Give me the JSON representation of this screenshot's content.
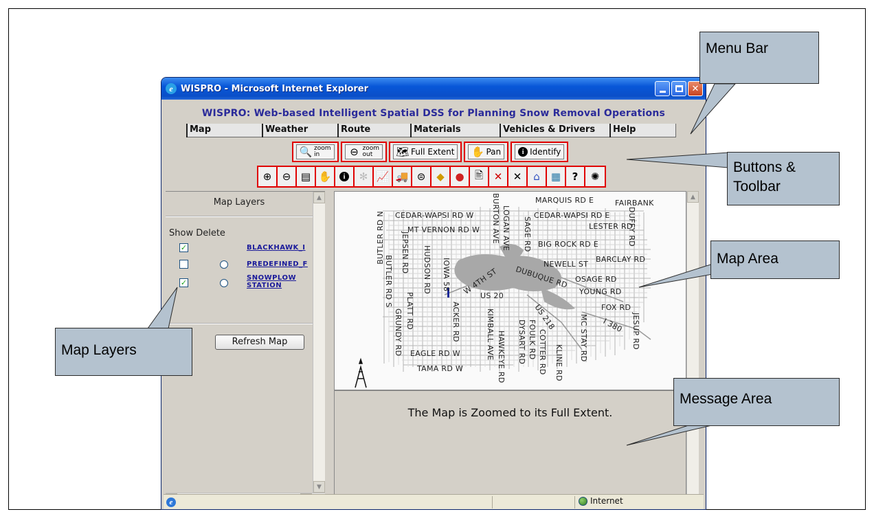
{
  "window": {
    "title": "WISPRO - Microsoft Internet Explorer"
  },
  "app": {
    "title": "WISPRO: Web-based Intelligent Spatial DSS for Planning Snow Removal Operations"
  },
  "menu": [
    "Map",
    "Weather",
    "Route",
    "Materials",
    "Vehicles & Drivers",
    "Help"
  ],
  "buttons": {
    "zoom_in_top": "zoom",
    "zoom_in_bottom": "in",
    "zoom_out_top": "zoom",
    "zoom_out_bottom": "out",
    "full_extent": "Full Extent",
    "pan": "Pan",
    "identify": "Identify"
  },
  "toolbar_icons": [
    "zoom-in-icon",
    "zoom-out-icon",
    "full-extent-icon",
    "pan-icon",
    "identify-icon",
    "settings-icon",
    "chart-icon",
    "truck-icon",
    "steering-wheel-icon",
    "warning-sign-icon",
    "stop-light-icon",
    "document-icon",
    "delete-icon",
    "clear-icon",
    "depot-icon",
    "calendar-icon",
    "help-icon",
    "alert-icon"
  ],
  "left_panel": {
    "title": "Map Layers",
    "col_show": "Show",
    "col_delete": "Delete",
    "layers": [
      {
        "name": "BLACKHAWK_I",
        "show": true,
        "has_delete": false
      },
      {
        "name": "PREDEFINED_F",
        "show": false,
        "has_delete": true
      },
      {
        "name": "SNOWPLOW",
        "name2": "STATION",
        "show": true,
        "has_delete": true
      }
    ],
    "refresh_label": "Refresh Map"
  },
  "map": {
    "labels": {
      "marquis": "MARQUIS RD E",
      "fairbank": "FAIRBANK",
      "cedar_w": "CEDAR-WAPSI RD W",
      "cedar_e": "CEDAR-WAPSI RD E",
      "lester": "LESTER RD",
      "mt_vernon": "MT VERNON RD W",
      "big_rock": "BIG ROCK RD E",
      "barclay": "BARCLAY RD",
      "newell": "NEWELL ST",
      "osage": "OSAGE RD",
      "young": "YOUNG RD",
      "dubuque": "DUBUQUE RD",
      "w4th": "W 4TH ST",
      "us20": "US 20",
      "fox": "FOX RD",
      "i380": "I 380",
      "us218": "US 218",
      "eagle": "EAGLE RD W",
      "tama": "TAMA RD W",
      "butler_n": "BUTLER RD N",
      "butler_s": "BUTLER RD S",
      "jepsen": "JEPSEN RD",
      "hudson": "HUDSON RD",
      "iowa58": "IOWA 58",
      "platt": "PLATT RD",
      "grundy": "GRUNDY RD",
      "acker": "ACKER RD",
      "burton": "BURTON AVE",
      "logan": "LOGAN AVE",
      "sage": "SAGE RD",
      "duffy": "DUFFY RD",
      "kimball": "KIMBALL AVE",
      "hawkeye": "HAWKEYE RD",
      "dysart": "DYSART RD",
      "foulk": "FOULK RD",
      "cotter": "COTTER RD",
      "kline": "KLINE RD",
      "mcstay": "MC STAY RD",
      "jesup": "JESUP RD"
    }
  },
  "message": "The Map is Zoomed to its Full Extent.",
  "status": {
    "zone": "Internet"
  },
  "callouts": {
    "menu_bar": "Menu Bar",
    "buttons_1": "Buttons &",
    "buttons_2": "Toolbar",
    "map_area": "Map Area",
    "message_area": "Message Area",
    "map_layers": "Map Layers"
  },
  "colors": {
    "title_blue": "#2b2b9a",
    "callout": "#b4c2cf",
    "button_border": "#e00000"
  }
}
